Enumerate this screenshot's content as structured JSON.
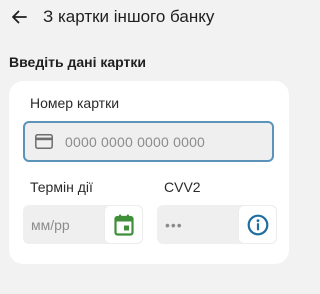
{
  "header": {
    "back_icon": "arrow-left-icon",
    "title": "З картки іншого банку"
  },
  "section": {
    "heading": "Введіть дані картки"
  },
  "form": {
    "card_number": {
      "label": "Номер картки",
      "placeholder": "0000 0000 0000 0000",
      "value": "",
      "icon": "credit-card-icon",
      "focused": true
    },
    "expiry": {
      "label": "Термін дії",
      "placeholder": "мм/рр",
      "value": "",
      "icon": "calendar-icon"
    },
    "cvv": {
      "label": "CVV2",
      "placeholder": "•••",
      "value": "",
      "icon": "info-icon"
    }
  },
  "colors": {
    "background": "#f2f2f2",
    "card": "#ffffff",
    "input_background": "#efefef",
    "focus_border": "#5b94b8",
    "calendar_icon": "#3f8f3a",
    "info_icon": "#1e6fa0",
    "text": "#1f1f1f",
    "placeholder": "#8c8c8c"
  }
}
